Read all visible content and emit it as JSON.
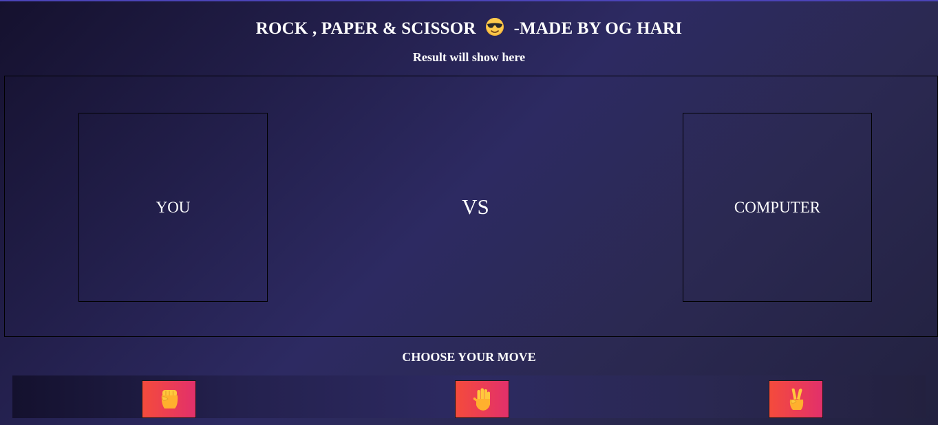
{
  "header": {
    "title_before": "ROCK , PAPER & SCISSOR",
    "title_emoji": "cool-face-sunglasses-icon",
    "title_after": "-MADE BY OG HARI"
  },
  "result": {
    "text": "Result will show here"
  },
  "arena": {
    "player_label": "YOU",
    "vs_label": "VS",
    "computer_label": "COMPUTER"
  },
  "moves": {
    "heading": "CHOOSE YOUR MOVE",
    "items": [
      {
        "name": "rock",
        "icon": "raised-fist-icon"
      },
      {
        "name": "paper",
        "icon": "raised-hand-icon"
      },
      {
        "name": "scissor",
        "icon": "victory-hand-icon"
      }
    ]
  },
  "colors": {
    "button_gradient_start": "#f44b3c",
    "button_gradient_end": "#e2306b",
    "background_dark": "#15112e",
    "background_mid": "#2d2a62"
  }
}
